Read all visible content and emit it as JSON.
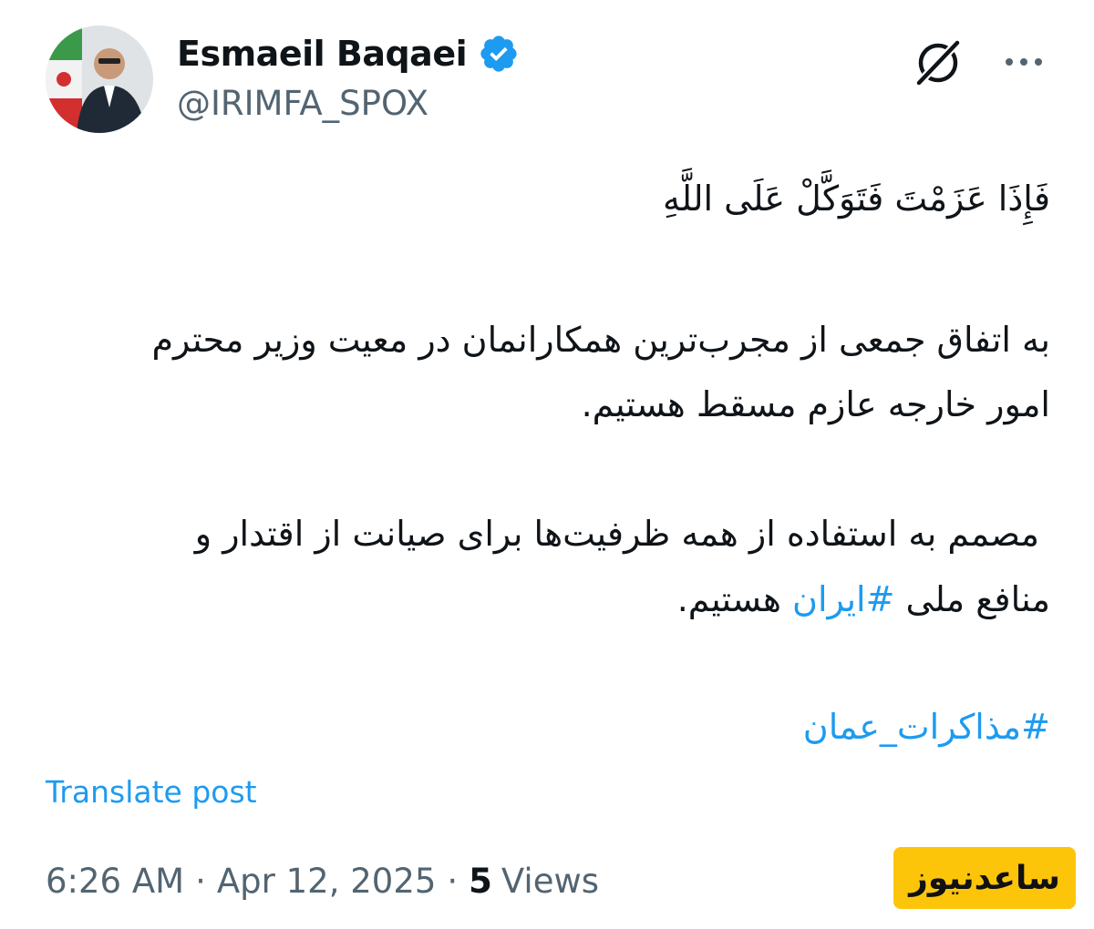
{
  "author": {
    "display_name": "Esmaeil Baqaei",
    "handle": "@IRIMFA_SPOX",
    "verified_icon": "verified-badge-icon",
    "avatar_icon": "profile-photo"
  },
  "header_actions": {
    "grok_icon": "grok-icon",
    "more_icon": "more-options-icon"
  },
  "post": {
    "ayah": "فَإِذَا عَزَمْتَ فَتَوَكَّلْ عَلَى اللَّهِ",
    "paragraph1_line1": "به اتفاق جمعی از مجرب‌ترین همکارانمان در معیت وزیر محترم",
    "paragraph1_line2": "امور خارجه عازم مسقط هستیم.",
    "paragraph2_line1": "مصمم به استفاده از همه ظرفیت‌ها برای صیانت از اقتدار و",
    "paragraph2_line2_prefix": "منافع ملی ",
    "paragraph2_hashtag": "#ایران",
    "paragraph2_line2_suffix": " هستیم.",
    "hashtag_line": "#مذاکرات_عمان"
  },
  "translate_label": "Translate post",
  "meta": {
    "time": "6:26 AM",
    "separator": "·",
    "date": "Apr 12, 2025",
    "views_count": "5",
    "views_label": "Views"
  },
  "watermark": {
    "text": "ساعدنیوز"
  },
  "colors": {
    "accent": "#1d9bf0",
    "text_primary": "#0f1419",
    "text_secondary": "#536471",
    "watermark_bg": "#fcc50a"
  }
}
